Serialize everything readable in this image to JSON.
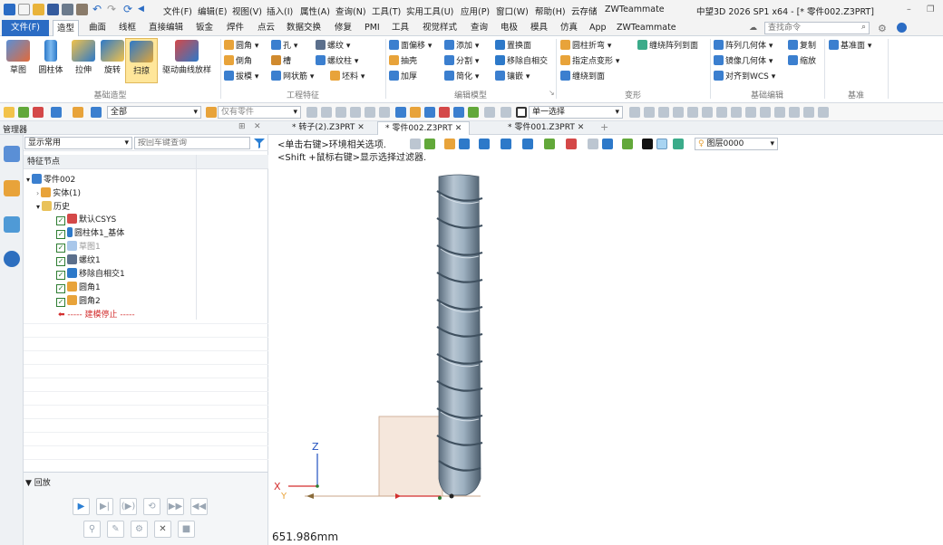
{
  "app": {
    "title": "中望3D 2026 SP1 x64 - [* 零件002.Z3PRT]"
  },
  "menubar": [
    "文件(F)",
    "编辑(E)",
    "视图(V)",
    "插入(I)",
    "属性(A)",
    "查询(N)",
    "工具(T)",
    "实用工具(U)",
    "应用(P)",
    "窗口(W)",
    "帮助(H)",
    "云存储",
    "ZWTeammate"
  ],
  "ribbon_tabs": [
    "文件(F)",
    "造型",
    "曲面",
    "线框",
    "直接编辑",
    "钣金",
    "焊件",
    "点云",
    "数据交换",
    "修复",
    "PMI",
    "工具",
    "视觉样式",
    "查询",
    "电极",
    "模具",
    "仿真",
    "App",
    "ZWTeammate"
  ],
  "search": {
    "placeholder": "查找命令"
  },
  "ribbon": {
    "basic": {
      "label": "基础造型",
      "buttons": [
        "草图",
        "圆柱体",
        "拉伸",
        "旋转",
        "扫掠",
        "驱动曲线放样"
      ]
    },
    "engineering": {
      "label": "工程特征",
      "items": [
        "圆角",
        "孔",
        "螺纹",
        "倒角",
        "槽",
        "螺纹柱",
        "拔模",
        "网状筋",
        "坯料"
      ]
    },
    "edit": {
      "label": "编辑模型",
      "items": [
        "面偏移",
        "添加",
        "置换面",
        "抽壳",
        "分割",
        "移除自相交",
        "加厚",
        "简化",
        "镶嵌"
      ]
    },
    "deform": {
      "label": "变形",
      "items": [
        "圆柱折弯",
        "缠绕阵列到面",
        "指定点变形",
        "缠绕到面"
      ]
    },
    "basic_edit": {
      "label": "基础编辑",
      "items": [
        "阵列几何体",
        "复制",
        "镜像几何体",
        "缩放",
        "对齐到WCS"
      ]
    },
    "datum": {
      "label": "基准",
      "items": [
        "基准面"
      ]
    }
  },
  "toolbar": {
    "filter_all": "全部",
    "filter_parts": "仅有零件",
    "select_mode": "单一选择"
  },
  "manager": {
    "title": "管理器",
    "display": "显示常用",
    "search_placeholder": "按回车键查询"
  },
  "doc_tabs": [
    "* 转子(2).Z3PRT",
    "* 零件002.Z3PRT",
    "* 零件001.Z3PRT"
  ],
  "tree": {
    "header": "特征节点",
    "root": "零件002",
    "solid": "实体(1)",
    "history": "历史",
    "items": [
      "默认CSYS",
      "圆柱体1_基体",
      "草图1",
      "螺纹1",
      "移除自相交1",
      "圆角1",
      "圆角2"
    ],
    "stop": "----- 建模停止 -----"
  },
  "playback": {
    "title": "回放"
  },
  "viewport": {
    "hint1": "<单击右键>环境相关选项.",
    "hint2": "<Shift +鼠标右键>显示选择过滤器.",
    "layer": "图层0000",
    "measure": "651.986mm",
    "axis_z": "Z",
    "axis_x": "X",
    "axis_y": "Y"
  }
}
